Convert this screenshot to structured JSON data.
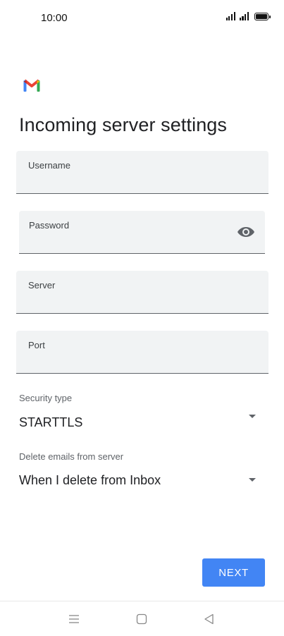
{
  "status_bar": {
    "time": "10:00"
  },
  "app": {
    "logo": "gmail-logo",
    "title": "Incoming server settings"
  },
  "fields": {
    "username": {
      "label": "Username",
      "value": ""
    },
    "password": {
      "label": "Password",
      "value": "",
      "toggle_icon": "eye-icon"
    },
    "server": {
      "label": "Server",
      "value": ""
    },
    "port": {
      "label": "Port",
      "value": ""
    }
  },
  "security": {
    "label": "Security type",
    "value": "STARTTLS"
  },
  "delete_emails": {
    "label": "Delete emails from server",
    "value": "When I delete from Inbox"
  },
  "actions": {
    "next_label": "NEXT"
  },
  "colors": {
    "accent": "#4285f4",
    "field_bg": "#f1f3f4"
  },
  "nav": {
    "icons": [
      "menu-icon",
      "home-icon",
      "back-icon"
    ]
  }
}
